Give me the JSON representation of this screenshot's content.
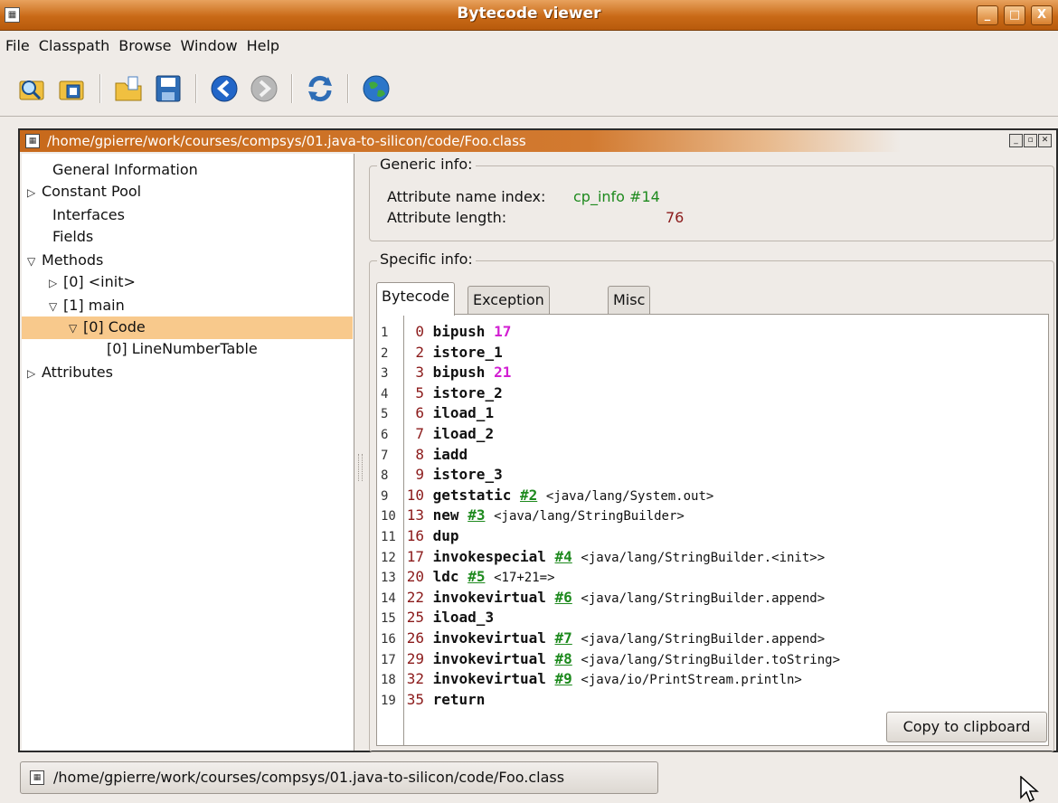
{
  "window": {
    "title": "Bytecode viewer",
    "min_label": "_",
    "max_label": "□",
    "close_label": "X"
  },
  "menu": [
    "File",
    "Classpath",
    "Browse",
    "Window",
    "Help"
  ],
  "toolbar_icons": [
    "open-class-icon",
    "open-jar-icon",
    "browse-folder-icon",
    "save-icon",
    "back-icon",
    "forward-icon",
    "refresh-icon",
    "web-icon"
  ],
  "internal_frame": {
    "title": "/home/gpierre/work/courses/compsys/01.java-to-silicon/code/Foo.class"
  },
  "tree": [
    {
      "label": "General Information",
      "level": 0,
      "expander": ""
    },
    {
      "label": "Constant Pool",
      "level": 0,
      "expander": "▷"
    },
    {
      "label": "Interfaces",
      "level": 0,
      "expander": ""
    },
    {
      "label": "Fields",
      "level": 0,
      "expander": ""
    },
    {
      "label": "Methods",
      "level": 0,
      "expander": "▽"
    },
    {
      "label": "[0] <init>",
      "level": 1,
      "expander": "▷"
    },
    {
      "label": "[1] main",
      "level": 1,
      "expander": "▽"
    },
    {
      "label": "[0] Code",
      "level": 2,
      "expander": "▽",
      "selected": true
    },
    {
      "label": "[0] LineNumberTable",
      "level": 3,
      "expander": ""
    },
    {
      "label": "Attributes",
      "level": 0,
      "expander": "▷"
    }
  ],
  "generic_info": {
    "legend": "Generic info:",
    "name_index_label": "Attribute name index:",
    "name_index_value": "cp_info #14",
    "length_label": "Attribute length:",
    "length_value": "76"
  },
  "specific_info": {
    "legend": "Specific info:",
    "tabs": [
      "Bytecode",
      "Exception table",
      "Misc"
    ],
    "active_tab": "Bytecode"
  },
  "bytecode": [
    {
      "line": "1",
      "offset": "0",
      "op": "bipush",
      "arg": "17",
      "comment": ""
    },
    {
      "line": "2",
      "offset": "2",
      "op": "istore_1",
      "arg": "",
      "comment": ""
    },
    {
      "line": "3",
      "offset": "3",
      "op": "bipush",
      "arg": "21",
      "comment": ""
    },
    {
      "line": "4",
      "offset": "5",
      "op": "istore_2",
      "arg": "",
      "comment": ""
    },
    {
      "line": "5",
      "offset": "6",
      "op": "iload_1",
      "arg": "",
      "comment": ""
    },
    {
      "line": "6",
      "offset": "7",
      "op": "iload_2",
      "arg": "",
      "comment": ""
    },
    {
      "line": "7",
      "offset": "8",
      "op": "iadd",
      "arg": "",
      "comment": ""
    },
    {
      "line": "8",
      "offset": "9",
      "op": "istore_3",
      "arg": "",
      "comment": ""
    },
    {
      "line": "9",
      "offset": "10",
      "op": "getstatic",
      "ref": "#2",
      "comment": "<java/lang/System.out>"
    },
    {
      "line": "10",
      "offset": "13",
      "op": "new",
      "ref": "#3",
      "comment": "<java/lang/StringBuilder>"
    },
    {
      "line": "11",
      "offset": "16",
      "op": "dup",
      "arg": "",
      "comment": ""
    },
    {
      "line": "12",
      "offset": "17",
      "op": "invokespecial",
      "ref": "#4",
      "comment": "<java/lang/StringBuilder.<init>>"
    },
    {
      "line": "13",
      "offset": "20",
      "op": "ldc",
      "ref": "#5",
      "comment": "<17+21=>"
    },
    {
      "line": "14",
      "offset": "22",
      "op": "invokevirtual",
      "ref": "#6",
      "comment": "<java/lang/StringBuilder.append>"
    },
    {
      "line": "15",
      "offset": "25",
      "op": "iload_3",
      "arg": "",
      "comment": ""
    },
    {
      "line": "16",
      "offset": "26",
      "op": "invokevirtual",
      "ref": "#7",
      "comment": "<java/lang/StringBuilder.append>"
    },
    {
      "line": "17",
      "offset": "29",
      "op": "invokevirtual",
      "ref": "#8",
      "comment": "<java/lang/StringBuilder.toString>"
    },
    {
      "line": "18",
      "offset": "32",
      "op": "invokevirtual",
      "ref": "#9",
      "comment": "<java/io/PrintStream.println>"
    },
    {
      "line": "19",
      "offset": "35",
      "op": "return",
      "arg": "",
      "comment": ""
    }
  ],
  "copy_button": "Copy to clipboard",
  "taskbar_item": "/home/gpierre/work/courses/compsys/01.java-to-silicon/code/Foo.class",
  "colors": {
    "title_orange": "#c96a17",
    "selection": "#f8c98c",
    "offset": "#8b1a1a",
    "number": "#d21fd2",
    "reference": "#1e8a1e"
  }
}
